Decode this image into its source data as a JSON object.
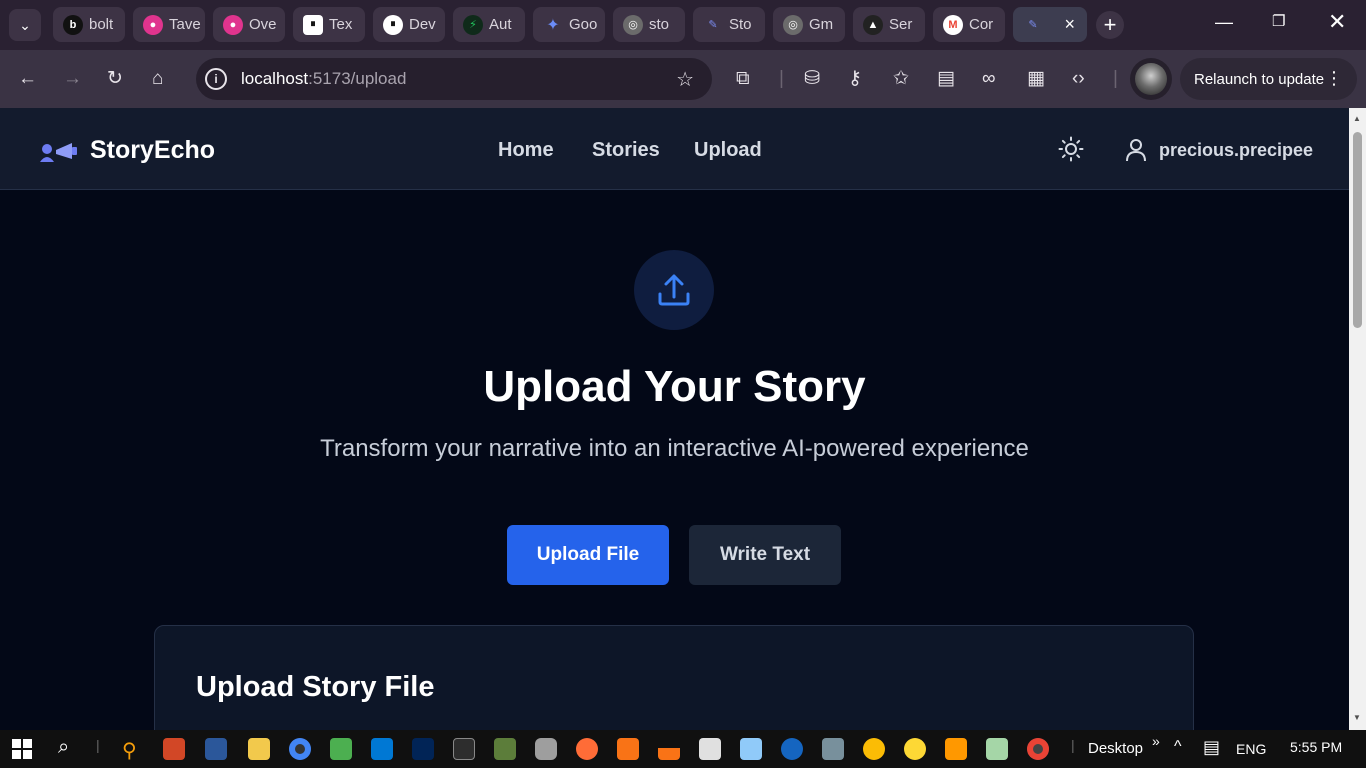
{
  "browser": {
    "tabs": [
      {
        "label": "bolt",
        "fav": "b",
        "color": "#111111"
      },
      {
        "label": "Tave",
        "fav": "●",
        "color": "#e0348e"
      },
      {
        "label": "Ove",
        "fav": "●",
        "color": "#e0348e"
      },
      {
        "label": "Tex",
        "fav": "⏸",
        "color": "#ffffff"
      },
      {
        "label": "Dev",
        "fav": "⏸",
        "color": "#ffffff"
      },
      {
        "label": "Aut",
        "fav": "⚡",
        "color": "#16a34a"
      },
      {
        "label": "Goo",
        "fav": "✦",
        "color": "#4a7bf7"
      },
      {
        "label": "sto",
        "fav": "◎",
        "color": "#6b6b6b"
      },
      {
        "label": "Sto",
        "fav": "✎",
        "color": "#5a6bd0"
      },
      {
        "label": "Gm",
        "fav": "◎",
        "color": "#6b6b6b"
      },
      {
        "label": "Ser",
        "fav": "▲",
        "color": "#222222"
      },
      {
        "label": "Cor",
        "fav": "M",
        "color": "#ea4335"
      }
    ],
    "active_tab_close": "×",
    "new_tab": "+",
    "url_host": "localhost",
    "url_path": ":5173/upload",
    "relaunch_label": "Relaunch to update",
    "toolbar_icons": [
      "back-icon",
      "forward-icon",
      "reload-icon",
      "home-icon",
      "extensions-icon",
      "incognito-icon",
      "password-key-icon",
      "favorites-icon",
      "reading-mode-icon",
      "link-icon",
      "sidepanel-icon",
      "devtools-icon"
    ]
  },
  "app": {
    "brand": "StoryEcho",
    "nav": {
      "home": "Home",
      "stories": "Stories",
      "upload": "Upload"
    },
    "username": "precious.precipee",
    "hero_title": "Upload Your Story",
    "hero_subtitle": "Transform your narrative into an interactive AI-powered experience",
    "upload_file_btn": "Upload File",
    "write_text_btn": "Write Text",
    "card_title": "Upload Story File",
    "accent": "#2563eb"
  },
  "taskbar": {
    "desktop_label": "Desktop",
    "chevron": "»",
    "language": "ENG",
    "time": "5:55 PM"
  }
}
